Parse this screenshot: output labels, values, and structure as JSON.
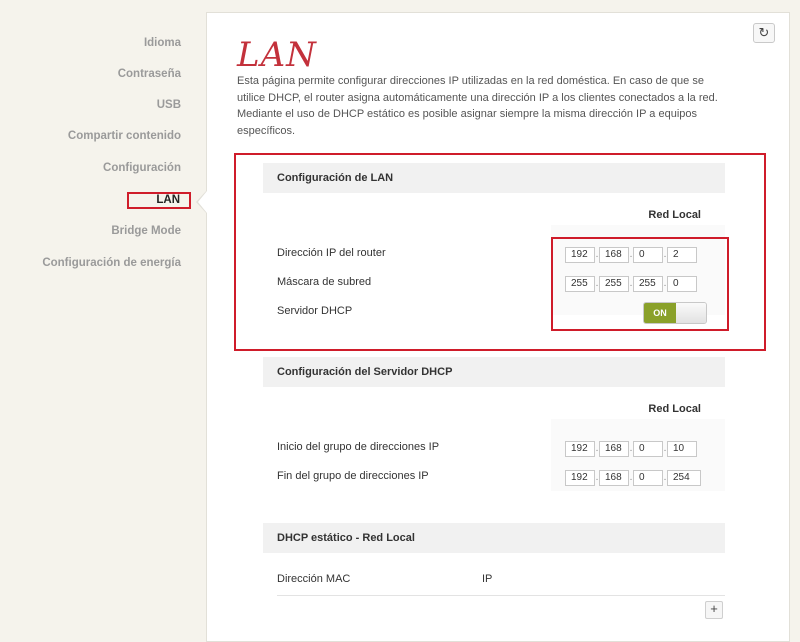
{
  "sidebar": {
    "items": [
      {
        "label": "Idioma"
      },
      {
        "label": "Contraseña"
      },
      {
        "label": "USB"
      },
      {
        "label": "Compartir contenido"
      },
      {
        "label": "Configuración"
      },
      {
        "label": "LAN"
      },
      {
        "label": "Bridge Mode"
      },
      {
        "label": "Configuración de energía"
      }
    ],
    "active": "LAN"
  },
  "page": {
    "title": "LAN",
    "intro": "Esta página permite configurar direcciones IP utilizadas en la red doméstica. En caso de que se utilice DHCP, el router asigna automáticamente una dirección IP a los clientes conectados a la red. Mediante el uso de DHCP estático es posible asignar siempre la misma dirección IP a equipos específicos.",
    "refresh_icon": "refresh-icon"
  },
  "lan_config": {
    "header": "Configuración de LAN",
    "column": "Red Local",
    "router_ip_label": "Dirección IP del router",
    "router_ip": [
      "192",
      "168",
      "0",
      "2"
    ],
    "subnet_label": "Máscara de subred",
    "subnet": [
      "255",
      "255",
      "255",
      "0"
    ],
    "dhcp_label": "Servidor DHCP",
    "dhcp_state": "ON"
  },
  "dhcp_server": {
    "header": "Configuración del Servidor DHCP",
    "column": "Red Local",
    "start_label": "Inicio del grupo de direcciones IP",
    "start_ip": [
      "192",
      "168",
      "0",
      "10"
    ],
    "end_label": "Fin del grupo de direcciones IP",
    "end_ip": [
      "192",
      "168",
      "0",
      "254"
    ]
  },
  "static_dhcp": {
    "header": "DHCP estático - Red Local",
    "mac_label": "Dirección MAC",
    "ip_label": "IP",
    "add_label": "+"
  },
  "colors": {
    "accent_red": "#cf1c2a",
    "title_red": "#c3313b",
    "toggle_green": "#8aa12a"
  }
}
